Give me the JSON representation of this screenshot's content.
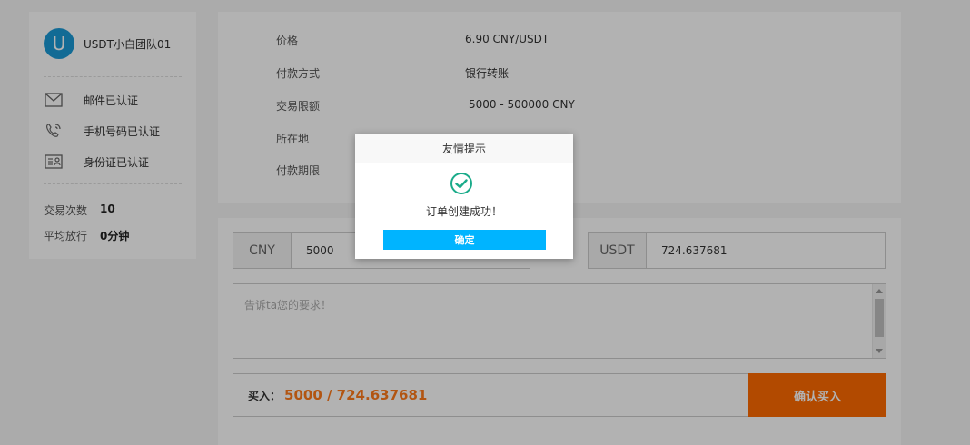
{
  "profile": {
    "avatar_letter": "U",
    "username": "USDT小白团队01",
    "verifications": [
      {
        "icon": "mail-icon",
        "label": "邮件已认证"
      },
      {
        "icon": "phone-icon",
        "label": "手机号码已认证"
      },
      {
        "icon": "id-card-icon",
        "label": "身份证已认证"
      }
    ],
    "stats": [
      {
        "label": "交易次数",
        "value": "10"
      },
      {
        "label": "平均放行",
        "value": "0分钟"
      }
    ]
  },
  "info": {
    "price_label": "价格",
    "price_value": "6.90 CNY/USDT",
    "payment_label": "付款方式",
    "payment_value": "银行转账",
    "limit_label": "交易限额",
    "limit_value": "5000 - 500000 CNY",
    "location_label": "所在地",
    "period_label": "付款期限"
  },
  "order": {
    "cny_currency": "CNY",
    "cny_amount": "5000",
    "usdt_currency": "USDT",
    "usdt_amount": "724.637681",
    "remark_placeholder": "告诉ta您的要求！",
    "buy_label": "买入：",
    "buy_value": "5000 / 724.637681",
    "confirm_button": "确认买入"
  },
  "modal": {
    "title": "友情提示",
    "icon": "check-circle-icon",
    "message": "订单创建成功！",
    "ok_button": "确定"
  },
  "colors": {
    "accent_orange": "#ff6a00",
    "avatar_blue": "#1a9ad6",
    "modal_button": "#00b4ff",
    "success_green": "#1aab8a"
  }
}
